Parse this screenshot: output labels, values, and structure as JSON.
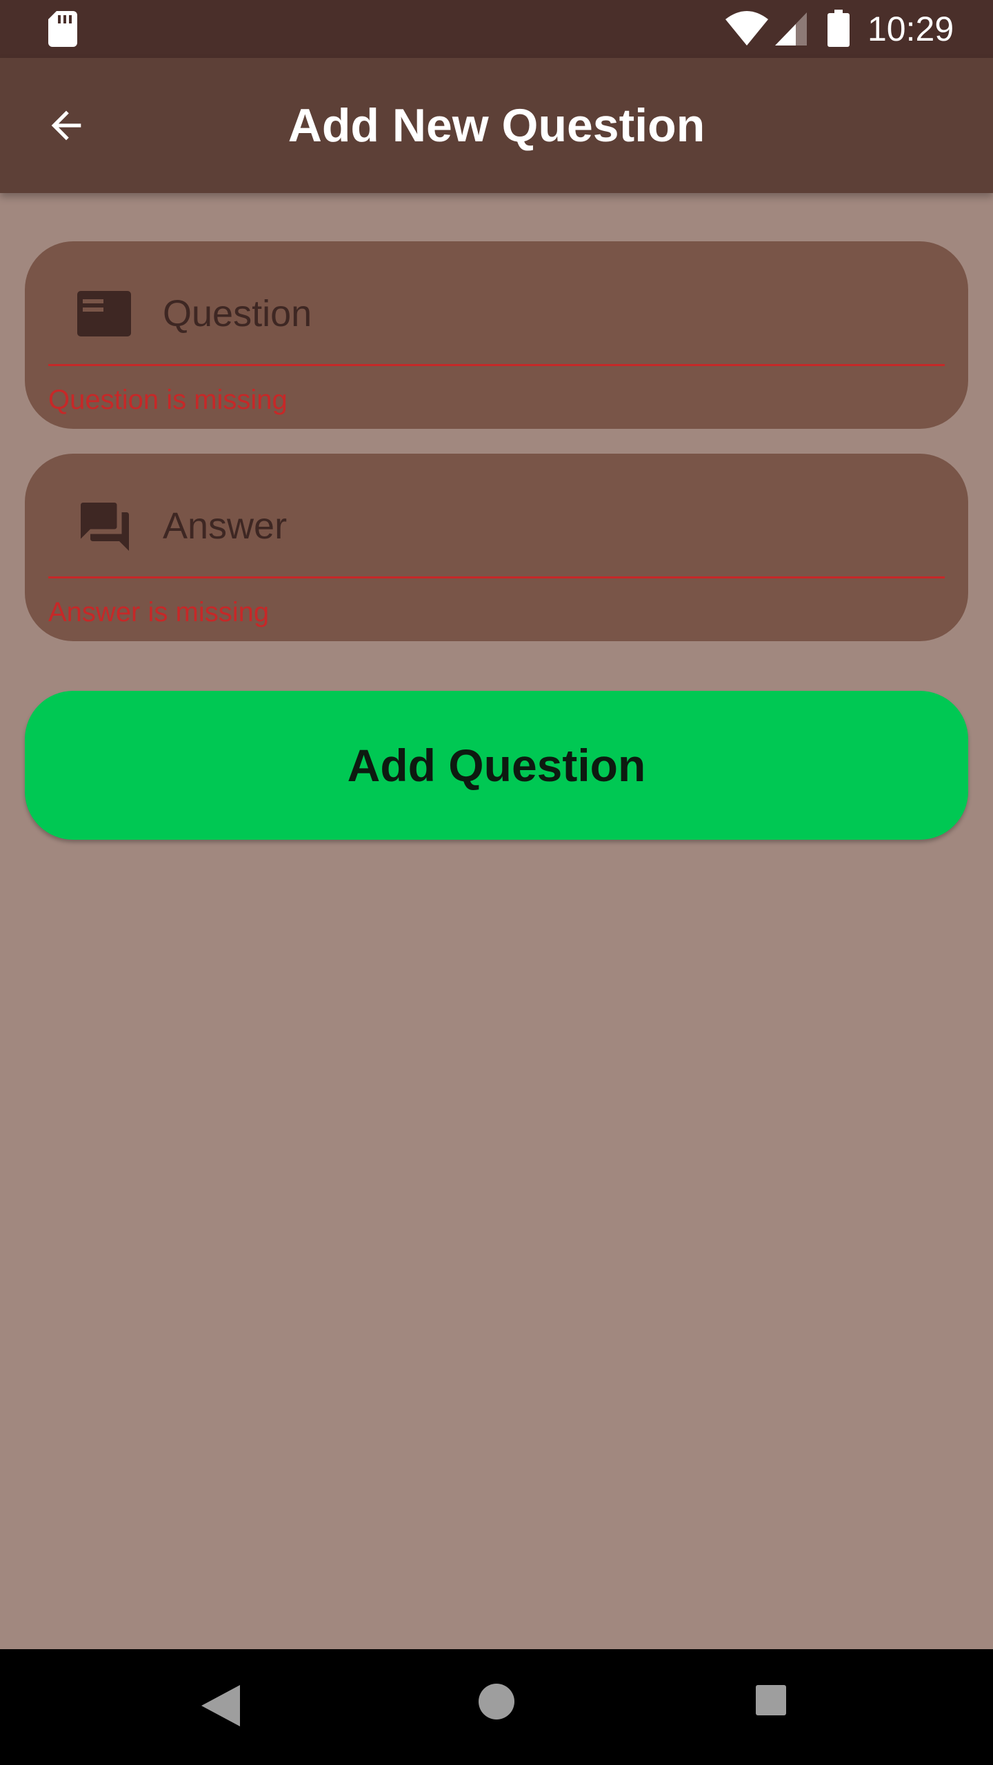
{
  "status_bar": {
    "time": "10:29",
    "icons": [
      "sd-card-icon",
      "wifi-icon",
      "signal-icon",
      "battery-icon"
    ]
  },
  "app_bar": {
    "title": "Add New Question",
    "back_icon": "arrow-back-icon"
  },
  "form": {
    "question": {
      "placeholder": "Question",
      "value": "",
      "icon": "card-icon",
      "error": "Question is missing"
    },
    "answer": {
      "placeholder": "Answer",
      "value": "",
      "icon": "forum-icon",
      "error": "Answer is missing"
    },
    "submit_label": "Add Question"
  },
  "nav_bar": {
    "icons": [
      "nav-back-icon",
      "nav-home-icon",
      "nav-recents-icon"
    ]
  },
  "colors": {
    "background": "#a1887f",
    "status_bar": "#4a2f2a",
    "app_bar": "#5d4037",
    "field": "#795548",
    "error": "#c62828",
    "button": "#00c853"
  }
}
